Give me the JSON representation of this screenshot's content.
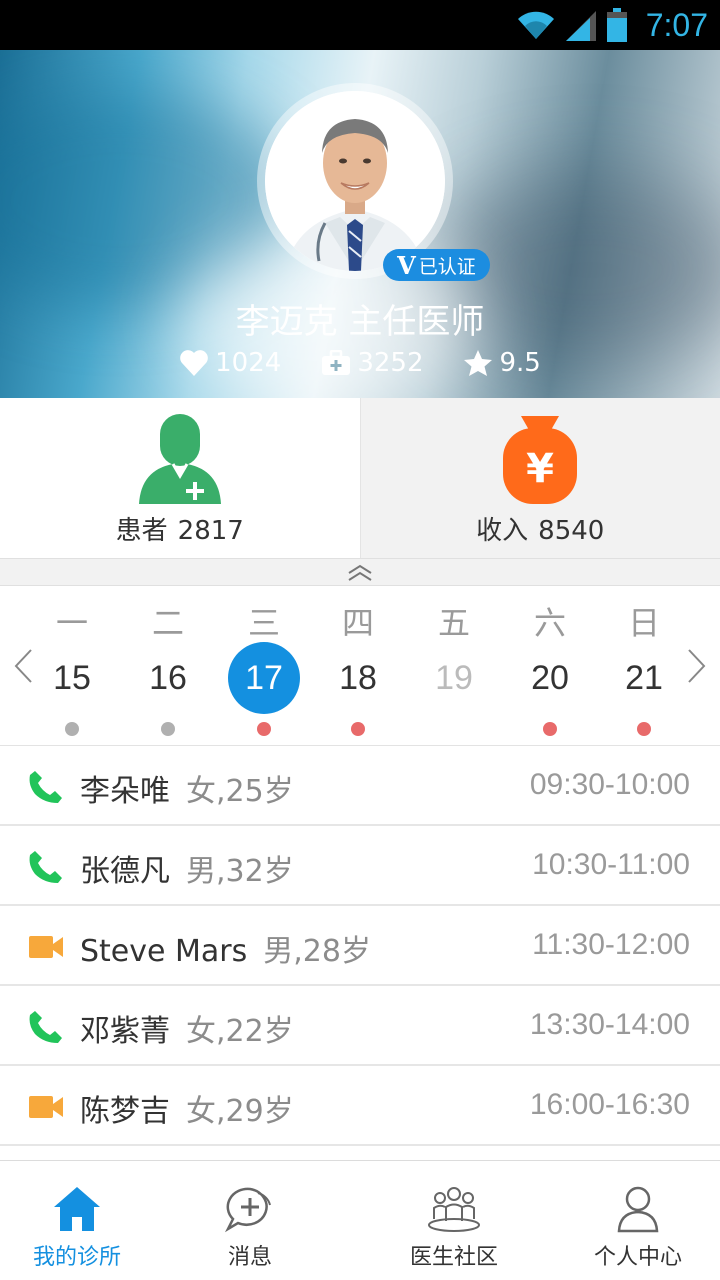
{
  "status_bar": {
    "time": "7:07"
  },
  "profile": {
    "verify_badge_letter": "V",
    "verify_badge_text": "已认证",
    "name_title": "李迈克 主任医师",
    "likes": "1024",
    "consultations": "3252",
    "rating": "9.5"
  },
  "cards": {
    "patients": {
      "label": "患者",
      "value": "2817"
    },
    "income": {
      "label": "收入",
      "value": "8540",
      "icon_text": "¥"
    }
  },
  "calendar": {
    "days": [
      {
        "weekday": "一",
        "date": "15",
        "state": "normal",
        "dot": "gray"
      },
      {
        "weekday": "二",
        "date": "16",
        "state": "normal",
        "dot": "gray"
      },
      {
        "weekday": "三",
        "date": "17",
        "state": "selected",
        "dot": "red"
      },
      {
        "weekday": "四",
        "date": "18",
        "state": "normal",
        "dot": "red"
      },
      {
        "weekday": "五",
        "date": "19",
        "state": "dim",
        "dot": "none"
      },
      {
        "weekday": "六",
        "date": "20",
        "state": "normal",
        "dot": "red"
      },
      {
        "weekday": "日",
        "date": "21",
        "state": "normal",
        "dot": "red"
      }
    ],
    "colors": {
      "selected": "#1490e0",
      "dot_gray": "#b0b0b0",
      "dot_red": "#e86a6a"
    }
  },
  "appointments": [
    {
      "type": "phone",
      "name": "李朵唯",
      "meta": "女,25岁",
      "time": "09:30-10:00"
    },
    {
      "type": "phone",
      "name": "张德凡",
      "meta": "男,32岁",
      "time": "10:30-11:00"
    },
    {
      "type": "video",
      "name": "Steve Mars",
      "meta": "男,28岁",
      "time": "11:30-12:00"
    },
    {
      "type": "phone",
      "name": "邓紫菁",
      "meta": "女,22岁",
      "time": "13:30-14:00"
    },
    {
      "type": "video",
      "name": "陈梦吉",
      "meta": "女,29岁",
      "time": "16:00-16:30"
    }
  ],
  "bottom_nav": {
    "tabs": [
      {
        "label": "我的诊所",
        "icon": "home-icon",
        "active": true
      },
      {
        "label": "消息",
        "icon": "chat-plus-icon",
        "active": false
      },
      {
        "label": "医生社区",
        "icon": "community-icon",
        "active": false
      },
      {
        "label": "个人中心",
        "icon": "person-icon",
        "active": false
      }
    ]
  },
  "icons": {
    "phone_color": "#21c45a",
    "video_color": "#f7a83b",
    "patient_color": "#3aae6a",
    "money_color": "#ff6a1a"
  }
}
